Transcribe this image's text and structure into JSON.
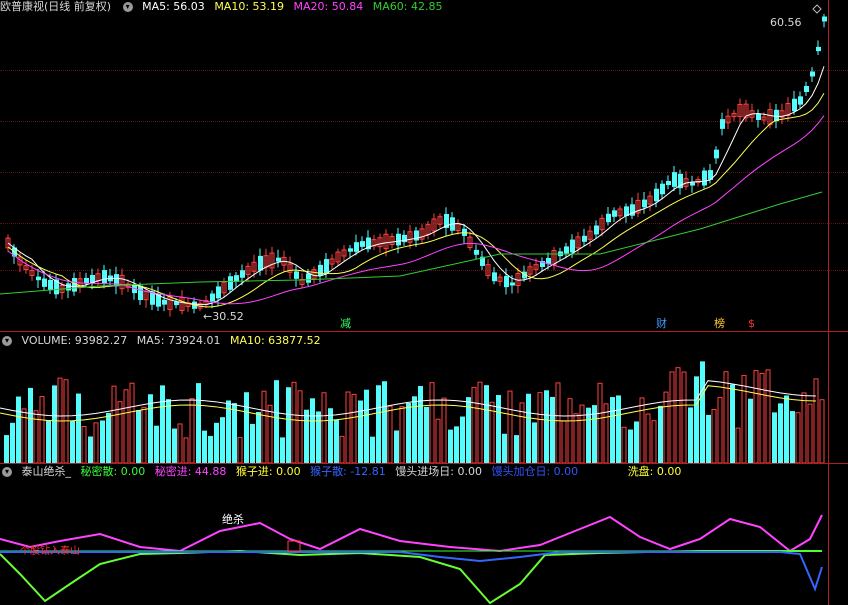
{
  "main": {
    "title": "欧普康视(日线 前复权)",
    "ma5": "MA5: 56.03",
    "ma10": "MA10: 53.19",
    "ma20": "MA20: 50.84",
    "ma60": "MA60: 42.85",
    "high_label": "60.56",
    "low_label": "30.52",
    "markers": [
      {
        "text": "减",
        "color": "#33ff66"
      },
      {
        "text": "财",
        "color": "#4499ff"
      },
      {
        "text": "榜",
        "color": "#ffcc33"
      },
      {
        "text": "$",
        "color": "#ff3333"
      }
    ],
    "colors": {
      "ma5": "#ffffff",
      "ma10": "#ffff55",
      "ma20": "#ff44ff",
      "ma60": "#33cc33",
      "up": "#ff4040",
      "down": "#54fcfc"
    }
  },
  "volume": {
    "title": "VOLUME: 93982.27",
    "ma5": "MA5: 73924.01",
    "ma10": "MA10: 63877.52"
  },
  "indicator": {
    "name": "泰山绝杀_",
    "mimi_san": "秘密散: 0.00",
    "mimi_jin": "秘密进: 44.88",
    "houzi_jin": "猴子进: 0.00",
    "houzi_san": "猴子散: -12.81",
    "mantou_jin": "馒头进场日: 0.00",
    "mantou_jia": "馒头加仓日: 0.00",
    "xipan": "洗盘: 0.00",
    "jusha_label": "绝杀",
    "tip_label": "个股钻入泰山"
  }
}
